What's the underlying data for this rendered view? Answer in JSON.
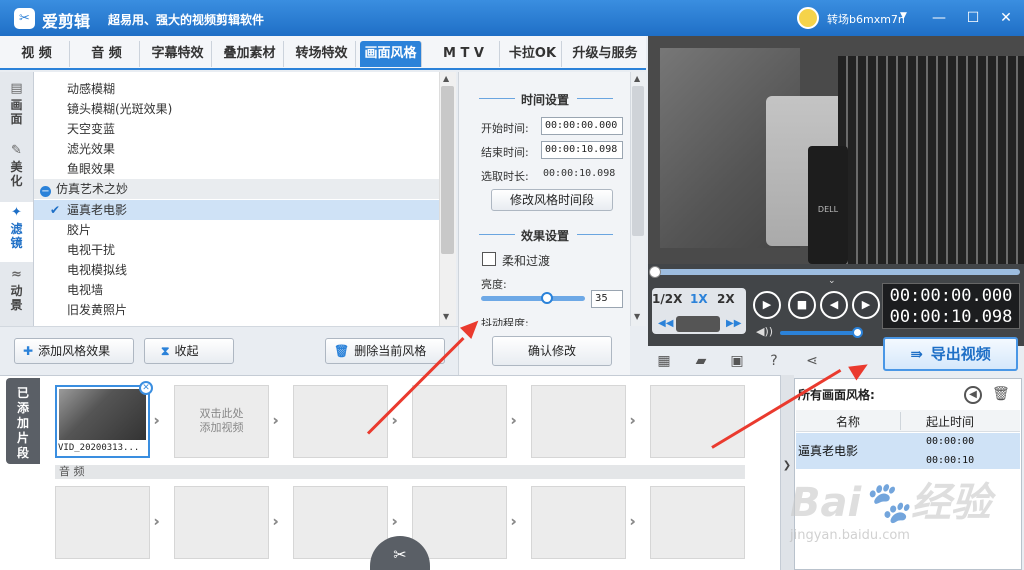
{
  "app": {
    "name": "爱剪辑",
    "slogan": "超易用、强大的视频剪辑软件",
    "logo_glyph": "✂",
    "username": "转场b6mxm7n",
    "brand_color": "#2b82d9"
  },
  "tabs": [
    "视 频",
    "音 频",
    "字幕特效",
    "叠加素材",
    "转场特效",
    "画面风格",
    "M T V",
    "卡拉OK",
    "升级与服务"
  ],
  "active_tab": "画面风格",
  "side_tabs": [
    {
      "label1": "画",
      "label2": "面",
      "icon": "film-icon"
    },
    {
      "label1": "美",
      "label2": "化",
      "icon": "brush-icon"
    },
    {
      "label1": "滤",
      "label2": "镜",
      "icon": "wand-icon"
    },
    {
      "label1": "动",
      "label2": "景",
      "icon": "wave-icon"
    }
  ],
  "effects_list": [
    {
      "label": "动感模糊",
      "type": "item"
    },
    {
      "label": "镜头模糊(光斑效果)",
      "type": "item"
    },
    {
      "label": "天空变蓝",
      "type": "item"
    },
    {
      "label": "滤光效果",
      "type": "item"
    },
    {
      "label": "鱼眼效果",
      "type": "item"
    },
    {
      "label": "仿真艺术之妙",
      "type": "group"
    },
    {
      "label": "逼真老电影",
      "type": "selected"
    },
    {
      "label": "胶片",
      "type": "item"
    },
    {
      "label": "电视干扰",
      "type": "item"
    },
    {
      "label": "电视模拟线",
      "type": "item"
    },
    {
      "label": "电视墙",
      "type": "item"
    },
    {
      "label": "旧发黄照片",
      "type": "item"
    }
  ],
  "list_buttons": {
    "add": "添加风格效果",
    "collapse": "收起",
    "delete": "删除当前风格"
  },
  "settings": {
    "time_section": "时间设置",
    "start_label": "开始时间:",
    "start_value": "00:00:00.000",
    "end_label": "结束时间:",
    "end_value": "00:00:10.098",
    "duration_label": "选取时长:",
    "duration_value": "00:00:10.098",
    "modify_button": "修改风格时间段",
    "effect_section": "效果设置",
    "smooth_label": "柔和过渡",
    "brightness_label": "亮度:",
    "brightness_value": "35",
    "shake_label": "抖动程度:",
    "confirm_button": "确认修改"
  },
  "player": {
    "speeds": [
      "1/2X",
      "1X",
      "2X"
    ],
    "active_speed": "1X",
    "current_time": "00:00:00.000",
    "total_time": "00:00:10.098",
    "preview_label": "DELL"
  },
  "export_button": "导出视频",
  "timeline": {
    "added_label": "已添加片段",
    "clip_name": "VID_20200313...",
    "add_hint_line1": "双击此处",
    "add_hint_line2": "添加视频",
    "audio_label": "音 频"
  },
  "style_panel": {
    "title": "所有画面风格:",
    "col_name": "名称",
    "col_time": "起止时间",
    "rows": [
      {
        "name": "逼真老电影",
        "start": "00:00:00",
        "end": "00:00:10"
      }
    ]
  },
  "watermark": {
    "logo": "Bai🐾经验",
    "url": "jingyan.baidu.com"
  }
}
